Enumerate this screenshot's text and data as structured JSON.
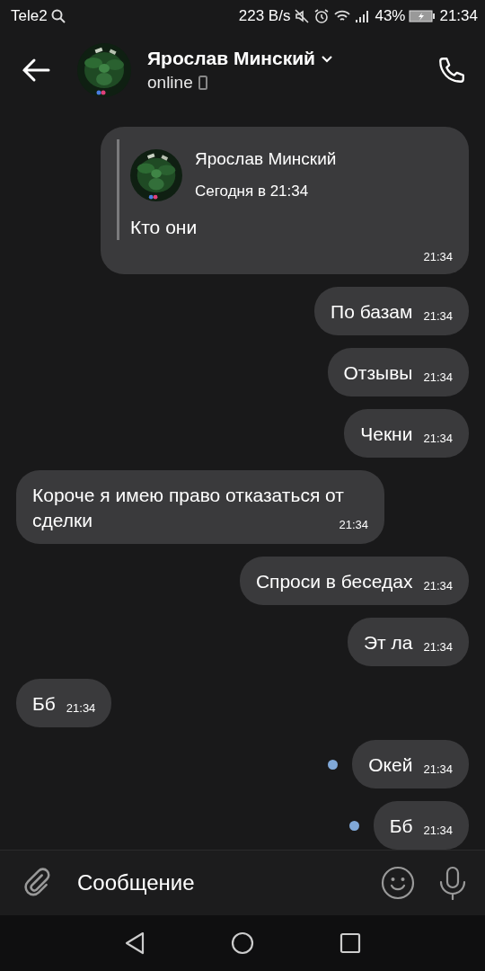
{
  "status_bar": {
    "carrier": "Tele2",
    "speed": "223 B/s",
    "battery": "43%",
    "time": "21:34"
  },
  "header": {
    "name": "Ярослав Минский",
    "status": "online"
  },
  "messages": [
    {
      "kind": "reply",
      "outgoing": true,
      "unread": false,
      "reply_name": "Ярослав Минский",
      "reply_date": "Сегодня в 21:34",
      "text": "Кто они",
      "time": "21:34"
    },
    {
      "kind": "text",
      "outgoing": true,
      "unread": false,
      "text": "По базам",
      "time": "21:34"
    },
    {
      "kind": "text",
      "outgoing": true,
      "unread": false,
      "text": "Отзывы",
      "time": "21:34"
    },
    {
      "kind": "text",
      "outgoing": true,
      "unread": false,
      "text": "Чекни",
      "time": "21:34"
    },
    {
      "kind": "text",
      "outgoing": false,
      "unread": false,
      "text": "Короче я имею право отказаться от сделки",
      "time": "21:34"
    },
    {
      "kind": "text",
      "outgoing": true,
      "unread": false,
      "text": "Спроси в беседах",
      "time": "21:34"
    },
    {
      "kind": "text",
      "outgoing": true,
      "unread": false,
      "text": "Эт ла",
      "time": "21:34"
    },
    {
      "kind": "text",
      "outgoing": false,
      "unread": false,
      "text": "Бб",
      "time": "21:34"
    },
    {
      "kind": "text",
      "outgoing": true,
      "unread": true,
      "text": "Окей",
      "time": "21:34"
    },
    {
      "kind": "text",
      "outgoing": true,
      "unread": true,
      "text": "Бб",
      "time": "21:34"
    }
  ],
  "composer": {
    "placeholder": "Сообщение"
  }
}
